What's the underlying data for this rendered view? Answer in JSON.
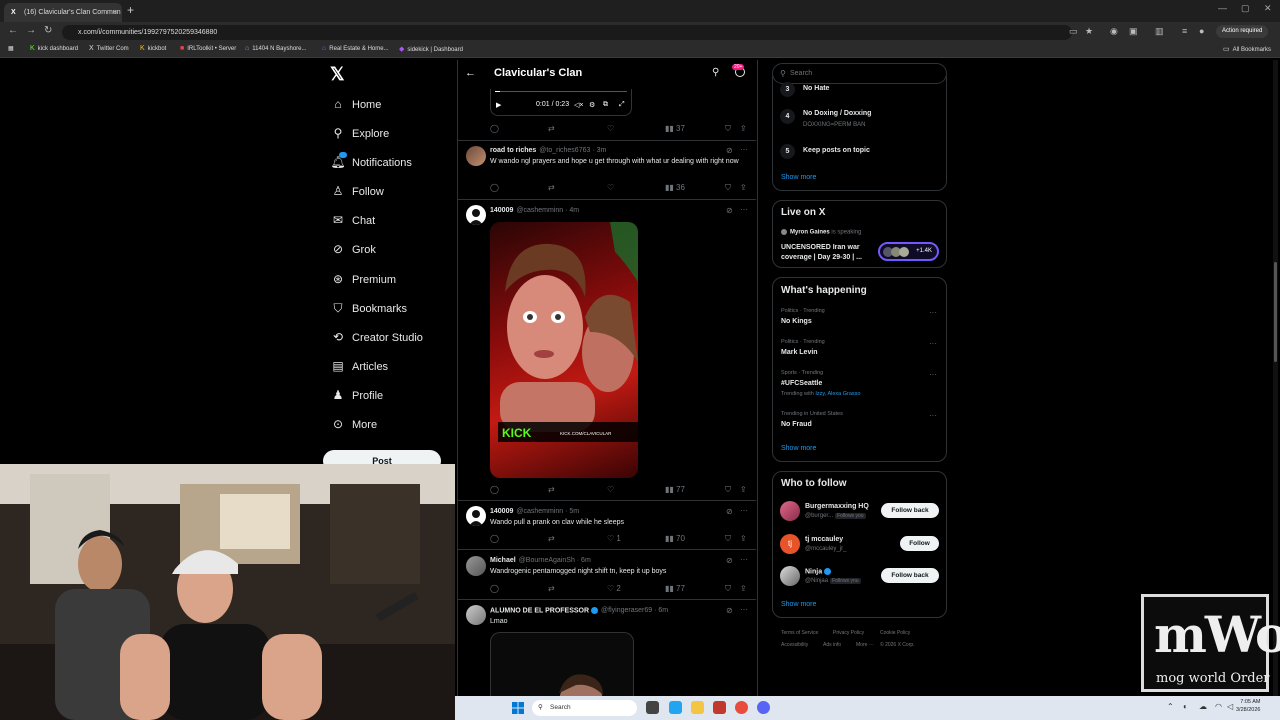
{
  "browser": {
    "tab_title": "(16) Clavicular's Clan Commun",
    "url": "x.com/i/communities/1992797520259346880",
    "action_required": "Action required",
    "bookmarks": [
      "kick dashboard",
      "Twitter Com",
      "kickbot",
      "IRLToolkit • Server",
      "11404 N Bayshore...",
      "Real Estate & Home...",
      "sidekick | Dashboard"
    ],
    "all_bookmarks": "All Bookmarks"
  },
  "nav": {
    "items": [
      "Home",
      "Explore",
      "Notifications",
      "Follow",
      "Chat",
      "Grok",
      "Premium",
      "Bookmarks",
      "Creator Studio",
      "Articles",
      "Profile",
      "More"
    ],
    "post_label": "Post"
  },
  "community": {
    "title": "Clavicular's Clan",
    "badge": "20+"
  },
  "video": {
    "time": "0:01 / 0:23"
  },
  "tweets": [
    {
      "views": "37"
    },
    {
      "name": "road to riches",
      "handle": "@to_riches6763 · 3m",
      "text": "W wando ngl prayers and hope u get through with what ur dealing with right now",
      "views": "36"
    },
    {
      "name": "140009",
      "handle": "@cashemminn · 4m",
      "media_text": "KICK",
      "media_url": "KICK.COM/CLAVICULAR",
      "views": "77"
    },
    {
      "name": "140009",
      "handle": "@cashemminn · 5m",
      "text": "Wando pull a prank on clav while he sleeps",
      "likes": "1",
      "views": "70"
    },
    {
      "name": "Michael",
      "handle": "@BourneAgainSh · 6m",
      "text": "Wandrogenic pentamogged night shift tn, keep it up boys",
      "likes": "2",
      "views": "77"
    },
    {
      "name": "ALUMNO DE EL PROFESSOR",
      "handle": "@flyingeraser69 · 6m",
      "text": "Lmao"
    }
  ],
  "right": {
    "search_placeholder": "Search",
    "rules": [
      {
        "num": "3",
        "title": "No Hate",
        "sub": ""
      },
      {
        "num": "4",
        "title": "No Doxing / Doxxing",
        "sub": "DOXXING=PERM BAN"
      },
      {
        "num": "5",
        "title": "Keep posts on topic",
        "sub": ""
      }
    ],
    "show_more": "Show more",
    "live": {
      "heading": "Live on X",
      "host": "Myron Gaines",
      "host_suffix": "is speaking",
      "title": "UNCENSORED Iran war coverage | Day 29-30 | ...",
      "count": "+1.4K"
    },
    "happening": {
      "heading": "What's happening",
      "trends": [
        {
          "meta": "Politics · Trending",
          "title": "No Kings",
          "with": ""
        },
        {
          "meta": "Politics · Trending",
          "title": "Mark Levin",
          "with": ""
        },
        {
          "meta": "Sports · Trending",
          "title": "#UFCSeattle",
          "with_prefix": "Trending with",
          "with": "Izzy, Alexa Grasso"
        },
        {
          "meta": "Trending in United States",
          "title": "No Fraud",
          "with": ""
        }
      ]
    },
    "who_to_follow": {
      "heading": "Who to follow",
      "users": [
        {
          "name": "Burgermaxxing HQ",
          "handle": "@burger...",
          "follows_you": "Follows you",
          "button": "Follow back"
        },
        {
          "name": "tj mccauley",
          "handle": "@mccauley_jr_",
          "follows_you": "",
          "button": "Follow"
        },
        {
          "name": "Ninja",
          "handle": "@Ninjaa",
          "follows_you": "Follows you",
          "button": "Follow back"
        }
      ]
    },
    "footer": [
      "Terms of Service",
      "Privacy Policy",
      "Cookie Policy",
      "Accessibility",
      "Ads info",
      "More ···",
      "© 2026 X Corp."
    ]
  },
  "overlay": {
    "logo_big": "mWo",
    "logo_small": "mog world Order"
  },
  "taskbar": {
    "search": "Search",
    "time": "7:05 AM",
    "date": "3/28/2026"
  }
}
